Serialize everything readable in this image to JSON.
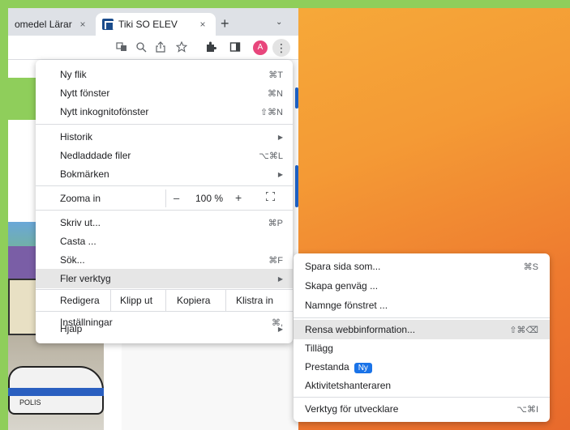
{
  "tabs": [
    {
      "title": "omedel Lärar",
      "close": "×"
    },
    {
      "title": "Tiki SO ELEV",
      "close": "×"
    }
  ],
  "tabstrip": {
    "new_tab": "+",
    "chevron": "⌄"
  },
  "toolbar": {
    "avatar_letter": "A",
    "menu_glyph": "⋮"
  },
  "illustration": {
    "car_text": "POLIS"
  },
  "menu": {
    "new_tab": {
      "label": "Ny flik",
      "shortcut": "⌘T"
    },
    "new_window": {
      "label": "Nytt fönster",
      "shortcut": "⌘N"
    },
    "incognito": {
      "label": "Nytt inkognitofönster",
      "shortcut": "⇧⌘N"
    },
    "history": {
      "label": "Historik",
      "arrow": "▶"
    },
    "downloads": {
      "label": "Nedladdade filer",
      "shortcut": "⌥⌘L"
    },
    "bookmarks": {
      "label": "Bokmärken",
      "arrow": "▶"
    },
    "zoom": {
      "label": "Zooma in",
      "minus": "–",
      "value": "100 %",
      "plus": "+"
    },
    "print": {
      "label": "Skriv ut...",
      "shortcut": "⌘P"
    },
    "cast": {
      "label": "Casta ..."
    },
    "find": {
      "label": "Sök...",
      "shortcut": "⌘F"
    },
    "more_tools": {
      "label": "Fler verktyg",
      "arrow": "▶"
    },
    "edit": {
      "label": "Redigera",
      "cut": "Klipp ut",
      "copy": "Kopiera",
      "paste": "Klistra in"
    },
    "settings": {
      "label": "Inställningar",
      "shortcut": "⌘,"
    },
    "help": {
      "label": "Hjälp",
      "arrow": "▶"
    }
  },
  "submenu": {
    "save_page": {
      "label": "Spara sida som...",
      "shortcut": "⌘S"
    },
    "create_shortcut": {
      "label": "Skapa genväg ..."
    },
    "name_window": {
      "label": "Namnge fönstret ..."
    },
    "clear_data": {
      "label": "Rensa webbinformation...",
      "shortcut": "⇧⌘⌫"
    },
    "extensions": {
      "label": "Tillägg"
    },
    "performance": {
      "label": "Prestanda",
      "badge": "Ny"
    },
    "task_manager": {
      "label": "Aktivitetshanteraren"
    },
    "dev_tools": {
      "label": "Verktyg för utvecklare",
      "shortcut": "⌥⌘I"
    }
  }
}
